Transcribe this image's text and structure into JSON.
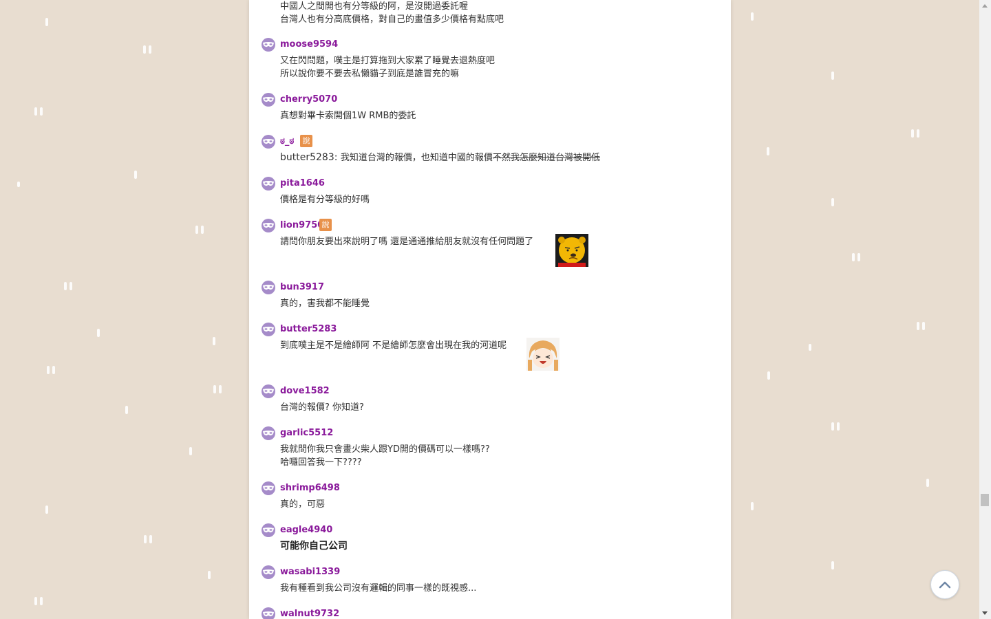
{
  "comments": [
    {
      "username": "",
      "lines": [
        "中國人之間開也有分等級的阿，是沒開過委託喔",
        "台灣人也有分高底價格，對自己的畫值多少價格有點底吧"
      ]
    },
    {
      "username": "moose9594",
      "lines": [
        "又在閃問題，噗主是打算拖到大家累了睡覺去退熱度吧",
        "所以說你要不要去私懶貓子到底是誰冒充的嘛"
      ]
    },
    {
      "username": "cherry5070",
      "lines": [
        "真想對畢卡索開個1W RMB的委託"
      ]
    },
    {
      "username": "ಠ_ಠ",
      "badge": "說",
      "quote_user": "butter5283",
      "quote_sep": ": ",
      "text_normal": "我知道台灣的報價，也知道中國的報價",
      "text_strike": "不然我怎麼知道台灣被開低"
    },
    {
      "username": "pita1646",
      "lines": [
        "價格是有分等級的好嗎"
      ]
    },
    {
      "username": "lion9750",
      "badge": "說",
      "lines": [
        "請問你朋友要出來說明了嗎 還是通通推給朋友就沒有任何問題了"
      ],
      "sticker": "winnie-pooh-sticker"
    },
    {
      "username": "bun3917",
      "lines": [
        "真的，害我都不能睡覺"
      ]
    },
    {
      "username": "butter5283",
      "lines": [
        "到底噗主是不是繪師阿 不是繪師怎麼會出現在我的河道呢"
      ],
      "sticker": "anime-girl-sticker"
    },
    {
      "username": "dove1582",
      "lines": [
        "台灣的報價? 你知道?"
      ]
    },
    {
      "username": "garlic5512",
      "lines": [
        "我就問你我只會畫火柴人跟YD開的價碼可以一樣嗎??",
        "哈囉回答我一下????"
      ]
    },
    {
      "username": "shrimp6498",
      "lines": [
        "真的，可惡"
      ]
    },
    {
      "username": "eagle4940",
      "lines": [
        "可能你自己公司"
      ]
    },
    {
      "username": "wasabi1339",
      "lines": [
        "我有種看到我公司沒有邏輯的同事一樣的既視感..."
      ]
    },
    {
      "username": "walnut9732",
      "lines": []
    }
  ],
  "colors": {
    "username": "#8a1a9b",
    "avatar": "#a58bc9",
    "badge": "#e8914a",
    "background": "#e8ddd0"
  },
  "icons": {
    "avatar": "mask-icon",
    "back_to_top": "chevron-up-icon"
  }
}
